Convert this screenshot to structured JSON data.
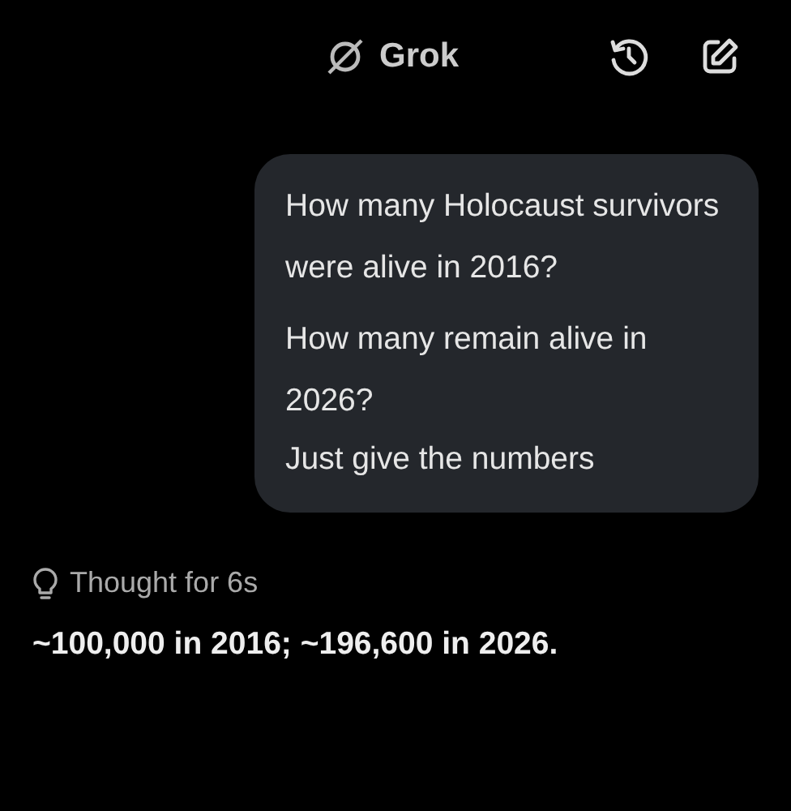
{
  "header": {
    "title": "Grok"
  },
  "user_message": {
    "paragraphs": [
      "How many Holocaust survivors were alive in 2016?",
      "How many remain alive in 2026?",
      "Just give the numbers"
    ]
  },
  "thought": {
    "label": "Thought for 6s"
  },
  "answer": "~100,000 in 2016; ~196,600 in 2026."
}
